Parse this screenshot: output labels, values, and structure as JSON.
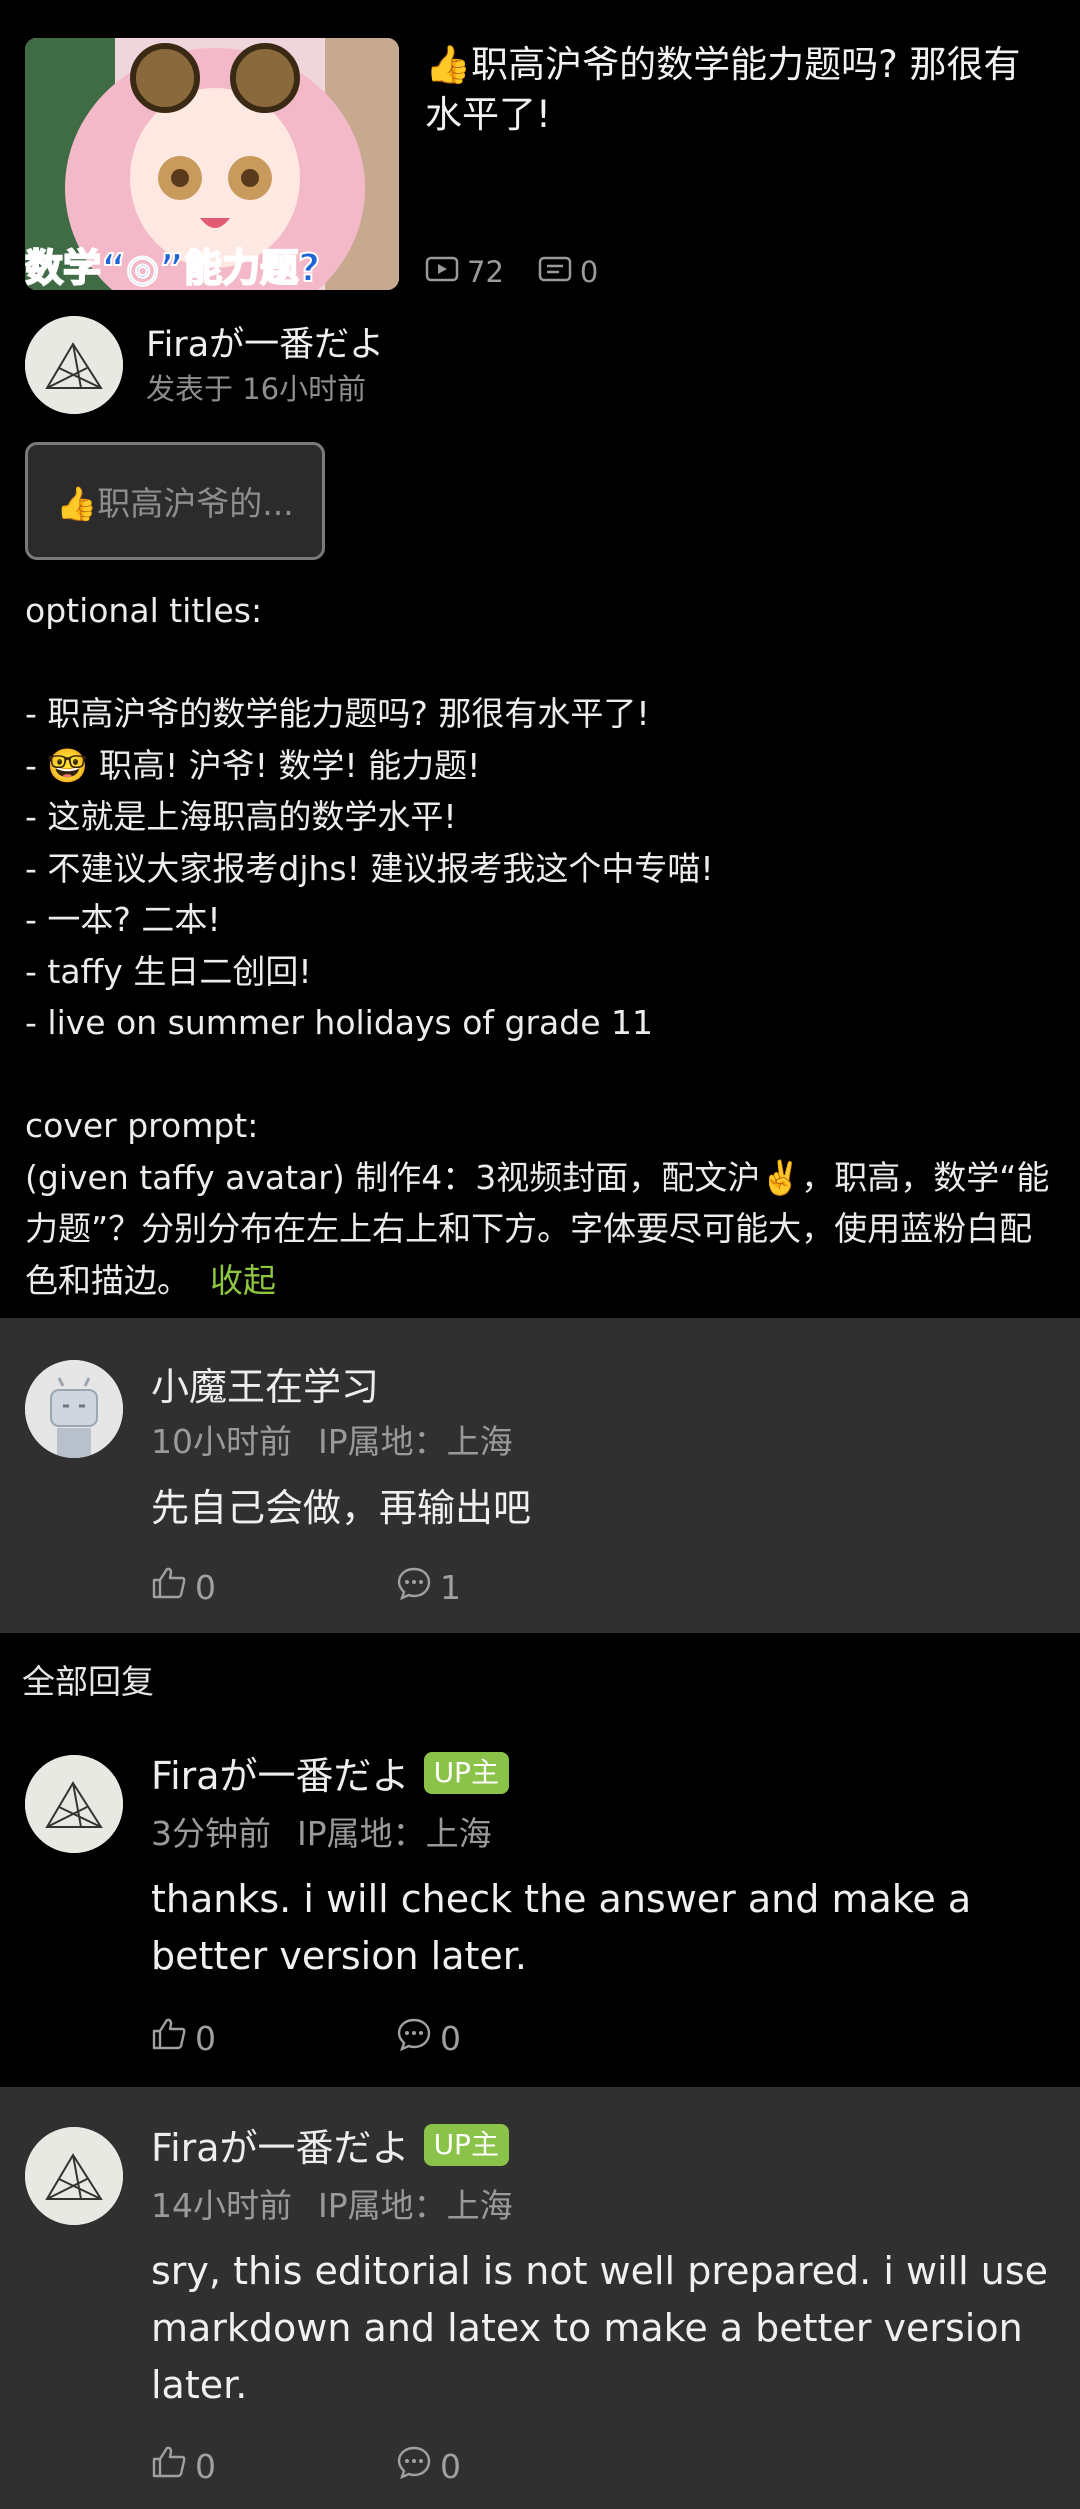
{
  "video": {
    "title": "👍职高沪爷的数学能力题吗? 那很有水平了!",
    "thumbnail_text": "数学“◎”能力题?",
    "views": "72",
    "danmaku": "0",
    "play_icon": "play-count-icon",
    "danmaku_icon": "danmaku-icon"
  },
  "post": {
    "author": "Firaが一番だよ",
    "time": "发表于 16小时前",
    "chip_label": "👍职高沪爷的...",
    "body": "optional titles:\n\n- 职高沪爷的数学能力题吗? 那很有水平了!\n- 🤓 职高! 沪爷! 数学! 能力题!\n- 这就是上海职高的数学水平!\n- 不建议大家报考djhs! 建议报考我这个中专喵!\n- 一本? 二本!\n- taffy 生日二创回!\n- live on summer holidays of grade 11\n\ncover prompt:\n(given taffy avatar) 制作4：3视频封面，配文沪✌️，职高，数学“能力题”？分别分布在左上右上和下方。字体要尽可能大，使用蓝粉白配色和描边。",
    "collapse_label": "收起"
  },
  "root_comment": {
    "name": "小魔王在学习",
    "time": "10小时前",
    "ip": "IP属地：上海",
    "text": "先自己会做，再输出吧",
    "likes": "0",
    "replies": "1"
  },
  "all_replies_label": "全部回复",
  "replies": [
    {
      "name": "Firaが一番だよ",
      "badge": "UP主",
      "time": "3分钟前",
      "ip": "IP属地：上海",
      "text": "thanks. i will check the answer and make a better version later.",
      "likes": "0",
      "replies": "0"
    },
    {
      "name": "Firaが一番だよ",
      "badge": "UP主",
      "time": "14小时前",
      "ip": "IP属地：上海",
      "text": "sry, this editorial is not well prepared. i will use markdown and latex to make a better version later.",
      "likes": "0",
      "replies": "0"
    }
  ],
  "colors": {
    "background": "#000000",
    "comment_bg": "#303030",
    "accent_green": "#8fc63f",
    "badge_green": "#8bc34a"
  }
}
